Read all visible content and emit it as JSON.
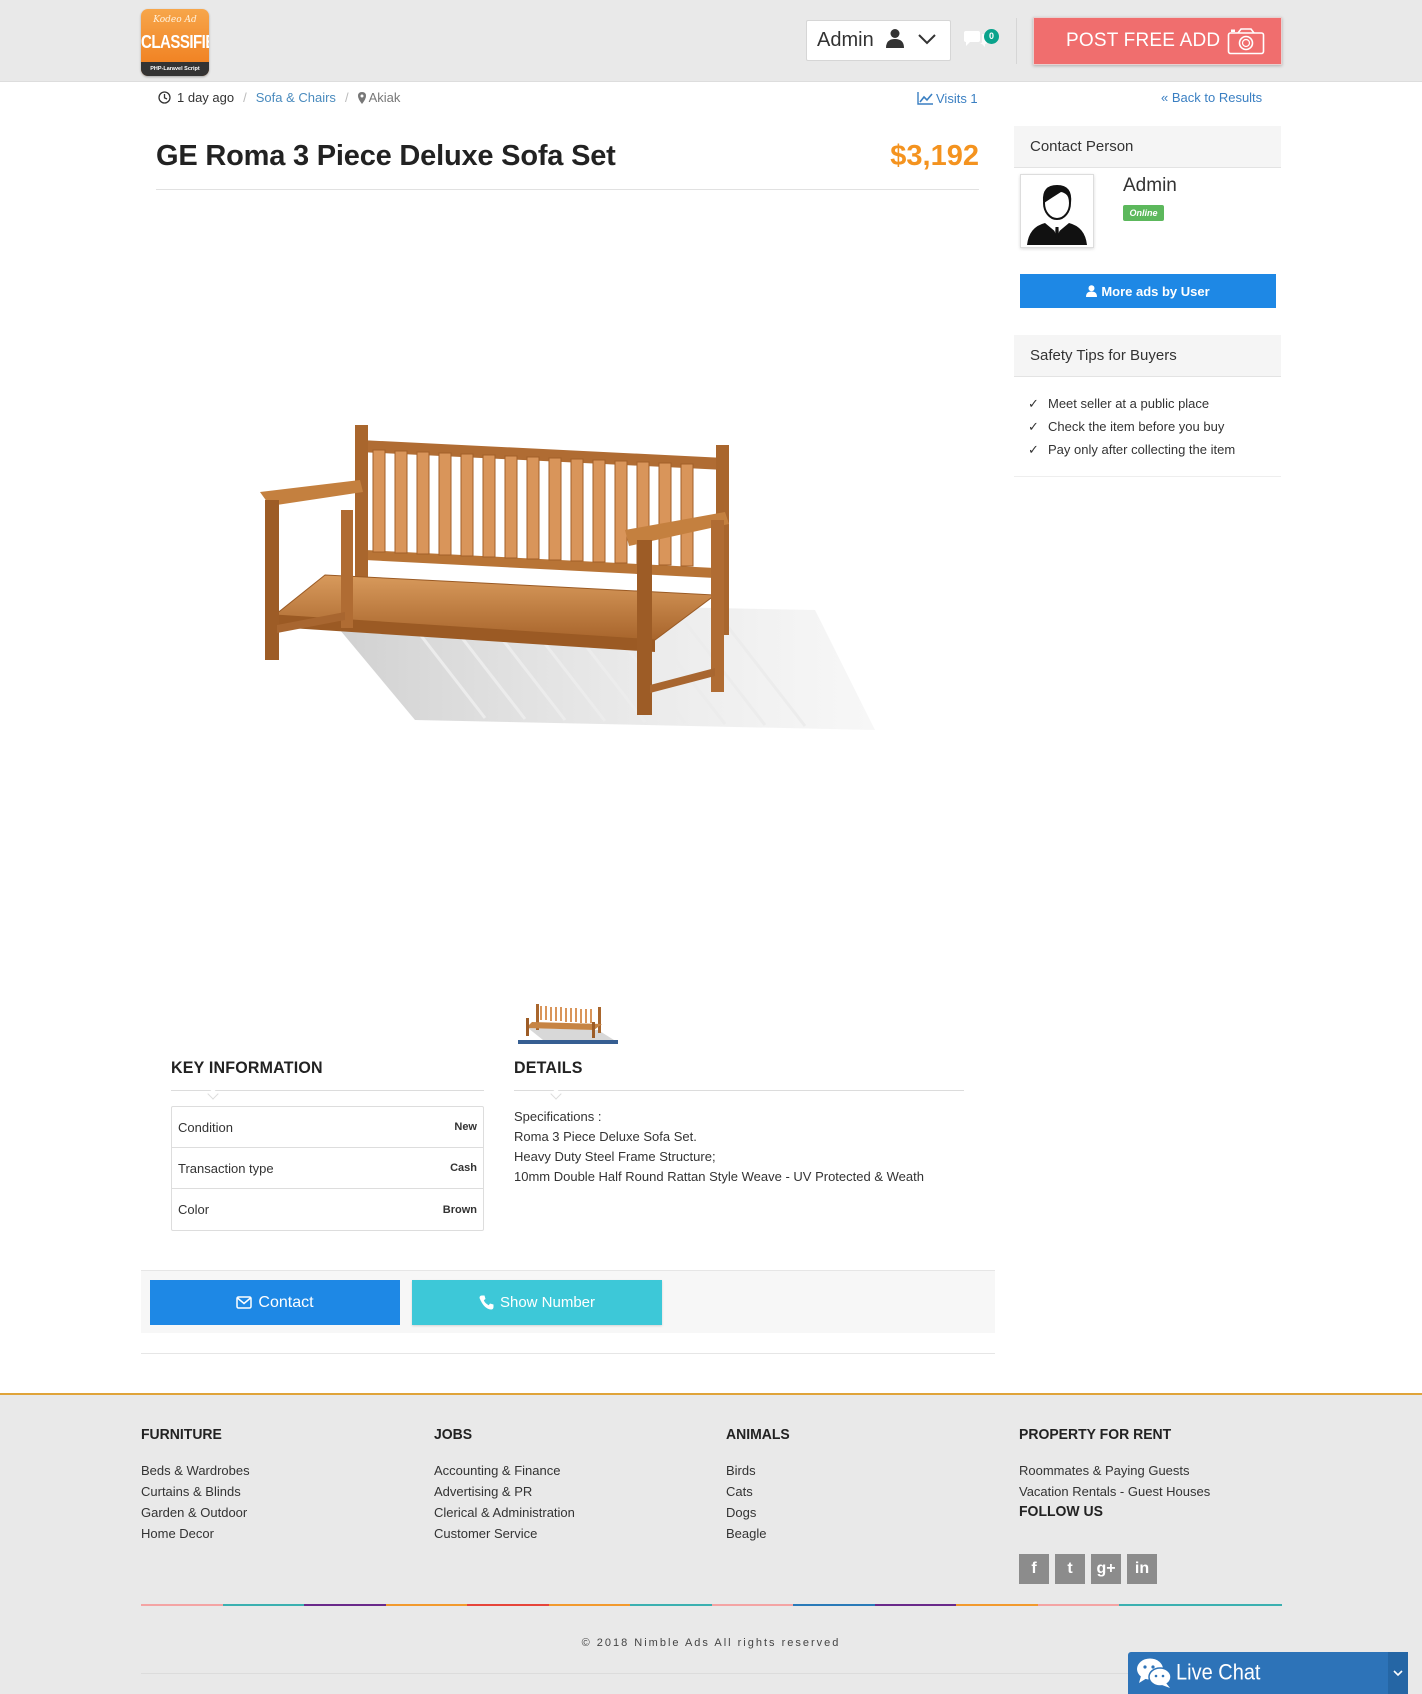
{
  "header": {
    "logo": {
      "top": "Kodeo Ad",
      "main": "CLASSIFIED",
      "sub": "PHP-Laravel Script"
    },
    "user_name": "Admin",
    "messages_count": "0",
    "post_button": "POST FREE ADD"
  },
  "breadcrumb": {
    "time": "1 day ago",
    "category": "Sofa & Chairs",
    "location": "Akiak",
    "visits": "Visits 1",
    "back": "Back to Results"
  },
  "listing": {
    "title": "GE Roma 3 Piece Deluxe Sofa Set",
    "price": "$3,192"
  },
  "key_info": {
    "heading": "KEY INFORMATION",
    "rows": [
      {
        "key": "Condition",
        "value": "New"
      },
      {
        "key": "Transaction type",
        "value": "Cash"
      },
      {
        "key": "Color",
        "value": "Brown"
      }
    ]
  },
  "details": {
    "heading": "DETAILS",
    "lines": [
      "Specifications :",
      "Roma 3 Piece Deluxe Sofa Set.",
      "Heavy Duty Steel Frame Structure;",
      "10mm Double Half Round Rattan Style Weave - UV Protected & Weath"
    ]
  },
  "actions": {
    "contact": "Contact",
    "show_number": "Show Number"
  },
  "sidebar": {
    "contact_heading": "Contact Person",
    "seller_name": "Admin",
    "status": "Online",
    "more_ads": "More ads by User",
    "safety_heading": "Safety Tips for Buyers",
    "tips": [
      "Meet seller at a public place",
      "Check the item before you buy",
      "Pay only after collecting the item"
    ]
  },
  "footer": {
    "columns": [
      {
        "title": "FURNITURE",
        "items": [
          "Beds & Wardrobes",
          "Curtains & Blinds",
          "Garden & Outdoor",
          "Home Decor"
        ]
      },
      {
        "title": "JOBS",
        "items": [
          "Accounting & Finance",
          "Advertising & PR",
          "Clerical & Administration",
          "Customer Service"
        ]
      },
      {
        "title": "ANIMALS",
        "items": [
          "Birds",
          "Cats",
          "Dogs",
          "Beagle"
        ]
      },
      {
        "title": "PROPERTY FOR RENT",
        "items": [
          "Roommates & Paying Guests",
          "Vacation Rentals - Guest Houses"
        ]
      }
    ],
    "follow_heading": "FOLLOW US",
    "social": [
      {
        "icon": "facebook-icon",
        "glyph": "f"
      },
      {
        "icon": "twitter-icon",
        "glyph": "t"
      },
      {
        "icon": "google-plus-icon",
        "glyph": "g+"
      },
      {
        "icon": "linkedin-icon",
        "glyph": "in"
      }
    ],
    "copyright": "© 2018 Nimble Ads All  rights reserved",
    "color_segments": [
      "#f4a4a4",
      "#3bb0b0",
      "#6a2a8a",
      "#f29a2e",
      "#e6453a",
      "#f29a2e",
      "#3bb0b0",
      "#f4a4a4",
      "#2a7ab8",
      "#6a2a8a",
      "#f29a2e",
      "#f4a4a4",
      "#3bb0b0",
      "#3bb0b0"
    ]
  },
  "live_chat": {
    "label": "Live Chat"
  },
  "colors": {
    "accent_blue": "#1e88e5",
    "accent_cyan": "#3dc8d8",
    "price_orange": "#f4931f",
    "post_button_red": "#f06e6e",
    "online_green": "#5cb85c"
  }
}
